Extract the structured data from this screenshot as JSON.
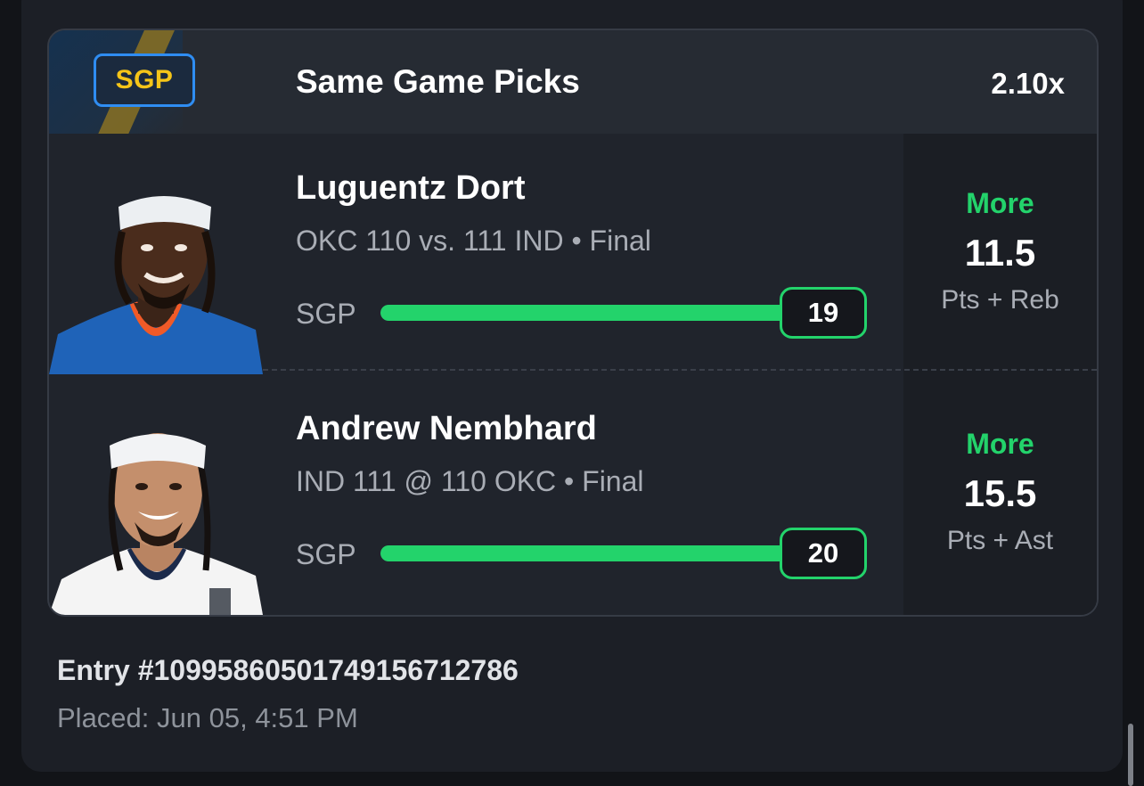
{
  "header": {
    "badge": "SGP",
    "title": "Same Game Picks",
    "multiplier": "2.10x"
  },
  "picks": [
    {
      "player": "Luguentz Dort",
      "game": "OKC 110 vs. 111 IND • Final",
      "progress_label": "SGP",
      "progress_value": "19",
      "progress_fraction": 1.0,
      "direction": "More",
      "line": "11.5",
      "stat": "Pts + Reb",
      "jersey_color": "#1f63b8",
      "trim_color": "#f05a28"
    },
    {
      "player": "Andrew Nembhard",
      "game": "IND 111 @ 110 OKC • Final",
      "progress_label": "SGP",
      "progress_value": "20",
      "progress_fraction": 1.0,
      "direction": "More",
      "line": "15.5",
      "stat": "Pts + Ast",
      "jersey_color": "#f4f4f4",
      "trim_color": "#1b2a4a"
    }
  ],
  "entry": {
    "id": "Entry #1099586050174915671278​6",
    "placed": "Placed: Jun 05, 4:51 PM"
  },
  "colors": {
    "accent_green": "#23d36b",
    "badge_blue": "#2f8df2",
    "badge_text": "#f5c518"
  }
}
